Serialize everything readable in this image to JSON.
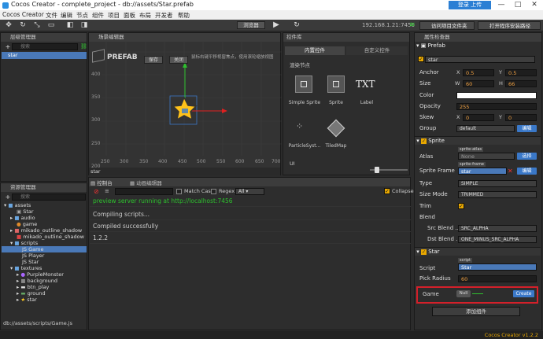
{
  "window": {
    "title": "Cocos Creator - complete_project - db://assets/Star.prefab",
    "connect": "登录 上传",
    "min": "—",
    "max": "□",
    "close": "✕"
  },
  "menu": [
    "Cocos Creator",
    "文件",
    "编辑",
    "节点",
    "组件",
    "项目",
    "面板",
    "布局",
    "开发者",
    "帮助"
  ],
  "toolbar": {
    "browser": "浏览器",
    "open_project": "访问项目文件夹",
    "open_install": "打开程序安装路径",
    "ip": "192.168.1.21:7456"
  },
  "hierarchy": {
    "title": "层级管理器",
    "search": "搜索",
    "root": "star"
  },
  "scene": {
    "title": "场景编辑器",
    "prefab_label": "PREFAB",
    "save": "保存",
    "close": "关闭",
    "hint": "鼠标右键平移视窗焦点，使用滚轮缩放视图",
    "node_name": "star",
    "y_ticks": [
      "400",
      "350",
      "300",
      "250",
      "200"
    ],
    "x_ticks": [
      "250",
      "300",
      "350",
      "400",
      "450",
      "500",
      "550",
      "600",
      "650",
      "700"
    ]
  },
  "widgets": {
    "title": "控件库",
    "tab_builtin": "内置控件",
    "tab_custom": "自定义控件",
    "section": "渲染节点",
    "items": [
      "Simple Sprite",
      "Sprite",
      "Label",
      "ParticleSyst...",
      "TiledMap"
    ],
    "ui": "UI"
  },
  "assets": {
    "title": "资源管理器",
    "search": "搜索",
    "tree": [
      "assets",
      "Star",
      "audio",
      "game",
      "mikado_outline_shadow",
      "mikado_outline_shadow",
      "scripts",
      "Game",
      "Player",
      "Star",
      "textures",
      "PurpleMonster",
      "background",
      "btn_play",
      "ground",
      "star"
    ],
    "path": "db://assets/scripts/Game.js"
  },
  "console": {
    "tab_console": "控制台",
    "tab_anim": "动画编辑器",
    "match_case": "Match Case",
    "regex": "Regex",
    "filter": "All",
    "collapse": "Collapse",
    "logs": [
      "preview server running at http://localhost:7456",
      "Compiling scripts...",
      "Compiled successfully",
      "1.2.2"
    ]
  },
  "inspector": {
    "title": "属性检查器",
    "node": {
      "header": "Prefab",
      "name": "star"
    },
    "anchor": {
      "label": "Anchor",
      "x": "0.5",
      "y": "0.5"
    },
    "size": {
      "label": "Size",
      "w": "60",
      "h": "66"
    },
    "color_label": "Color",
    "opacity": {
      "label": "Opacity",
      "value": "255"
    },
    "skew": {
      "label": "Skew",
      "x": "0",
      "y": "0"
    },
    "group": {
      "label": "Group",
      "value": "default",
      "edit": "编辑"
    },
    "sprite": {
      "header": "Sprite",
      "atlas_label": "Atlas",
      "atlas_tag": "sprite-atlas",
      "atlas_value": "None",
      "atlas_btn": "选择",
      "frame_label": "Sprite Frame",
      "frame_tag": "sprite-frame",
      "frame_value": "star",
      "frame_btn": "编辑",
      "type_label": "Type",
      "type_value": "SIMPLE",
      "size_mode_label": "Size Mode",
      "size_mode_value": "TRIMMED",
      "trim_label": "Trim",
      "blend_label": "Blend",
      "src_label": "Src Blend ...",
      "src_value": "SRC_ALPHA",
      "dst_label": "Dst Blend ...",
      "dst_value": "ONE_MINUS_SRC_ALPHA"
    },
    "star": {
      "header": "Star",
      "script_label": "Script",
      "script_tag": "script",
      "script_value": "Star",
      "pick_label": "Pick Radius",
      "pick_value": "60",
      "game_label": "Game",
      "game_value": "Null",
      "create": "Create"
    },
    "add_component": "添加组件"
  },
  "status": {
    "version": "Cocos Creator v1.2.2"
  },
  "colors": {
    "accent": "#3a78c8",
    "highlight_box": "#d4202a",
    "selection": "#4a79b8"
  }
}
